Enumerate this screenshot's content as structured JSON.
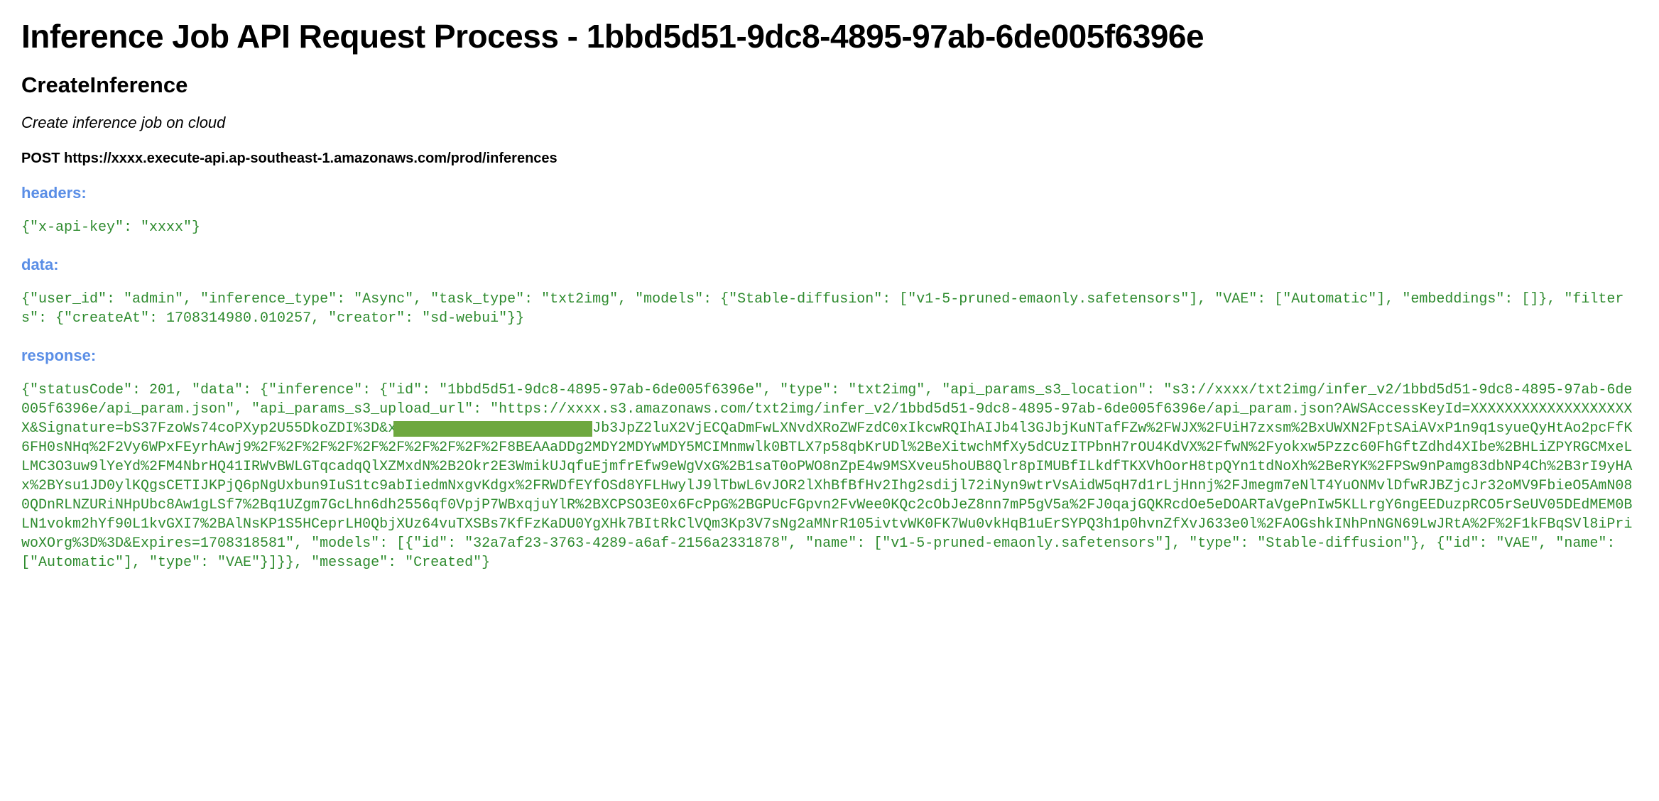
{
  "title": "Inference Job API Request Process - 1bbd5d51-9dc8-4895-97ab-6de005f6396e",
  "operation": "CreateInference",
  "subtitle": "Create inference job on cloud",
  "endpoint": "POST https://xxxx.execute-api.ap-southeast-1.amazonaws.com/prod/inferences",
  "labels": {
    "headers": "headers:",
    "data": "data:",
    "response": "response:"
  },
  "headers_block": "{\"x-api-key\": \"xxxx\"}",
  "data_block": "{\"user_id\": \"admin\", \"inference_type\": \"Async\", \"task_type\": \"txt2img\", \"models\": {\"Stable-diffusion\": [\"v1-5-pruned-emaonly.safetensors\"], \"VAE\": [\"Automatic\"], \"embeddings\": []}, \"filters\": {\"createAt\": 1708314980.010257, \"creator\": \"sd-webui\"}}",
  "response_block": "{\"statusCode\": 201, \"data\": {\"inference\": {\"id\": \"1bbd5d51-9dc8-4895-97ab-6de005f6396e\", \"type\": \"txt2img\", \"api_params_s3_location\": \"s3://xxxx/txt2img/infer_v2/1bbd5d51-9dc8-4895-97ab-6de005f6396e/api_param.json\", \"api_params_s3_upload_url\": \"https://xxxx.s3.amazonaws.com/txt2img/infer_v2/1bbd5d51-9dc8-4895-97ab-6de005f6396e/api_param.json?AWSAccessKeyId=XXXXXXXXXXXXXXXXXXXX&Signature=bS37FzoWs74coPXyp2U55DkoZDI%3D&x-amz-security-token=IQoJb3JpZ2luX2VjECQaDmFwLXNvdXRoZWFzdC0xIkcwRQIhAIJb4l3GJbjKuNTafFZw%2FWJX%2FUiH7zxsm%2BxUWXN2FptSAiAVxP1n9q1syueQyHtAo2pcFfK6FH0sNHq%2F2Vy6WPxFEyrhAwj9%2F%2F%2F%2F%2F%2F%2F%2F%2F%2F8BEAAaDDg2MDY2MDYwMDY5MCIMnmwlk0BTLX7p58qbKrUDl%2BeXitwchMfXy5dCUzITPbnH7rOU4KdVX%2FfwN%2Fyokxw5Pzzc60FhGftZdhd4XIbe%2BHLiZPYRGCMxeLLMC3O3uw9lYeYd%2FM4NbrHQ41IRWvBWLGTqcadqQlXZMxdN%2B2Okr2E3WmikUJqfuEjmfrEfw9eWgVxG%2B1saT0oPWO8nZpE4w9MSXveu5hoUB8Qlr8pIMUBfILkdfTKXVhOorH8tpQYn1tdNoXh%2BeRYK%2FPSw9nPamg83dbNP4Ch%2B3rI9yHAx%2BYsu1JD0ylKQgsCETIJKPjQ6pNgUxbun9IuS1tc9abIiedmNxgvKdgx%2FRWDfEYfOSd8YFLHwylJ9lTbwL6vJOR2lXhBfBfHv2Ihg2sdijl72iNyn9wtrVsAidW5qH7d1rLjHnnj%2FJmegm7eNlT4YuONMvlDfwRJBZjcJr32oMV9FbieO5AmN080QDnRLNZURiNHpUbc8Aw1gLSf7%2Bq1UZgm7GcLhn6dh2556qf0VpjP7WBxqjuYlR%2BXCPSO3E0x6FcPpG%2BGPUcFGpvn2FvWee0KQc2cObJeZ8nn7mP5gV5a%2FJ0qajGQKRcdOe5eDOARTaVgePnIw5KLLrgY6ngEEDuzpRCO5rSeUV05DEdMEM0BLN1vokm2hYf90L1kvGXI7%2BAlNsKP1S5HCeprLH0QbjXUz64vuTXSBs7KfFzKaDU0YgXHk7BItRkClVQm3Kp3V7sNg2aMNrR105ivtvWK0FK7Wu0vkHqB1uErSYPQ3h1p0hvnZfXvJ633e0l%2FAOGshkINhPnNGN69LwJRtA%2F%2F1kFBqSVl8iPriwoXOrg%3D%3D&Expires=1708318581\", \"models\": [{\"id\": \"32a7af23-3763-4289-a6af-2156a2331878\", \"name\": [\"v1-5-pruned-emaonly.safetensors\"], \"type\": \"Stable-diffusion\"}, {\"id\": \"VAE\", \"name\": [\"Automatic\"], \"type\": \"VAE\"}]}}, \"message\": \"Created\"}"
}
